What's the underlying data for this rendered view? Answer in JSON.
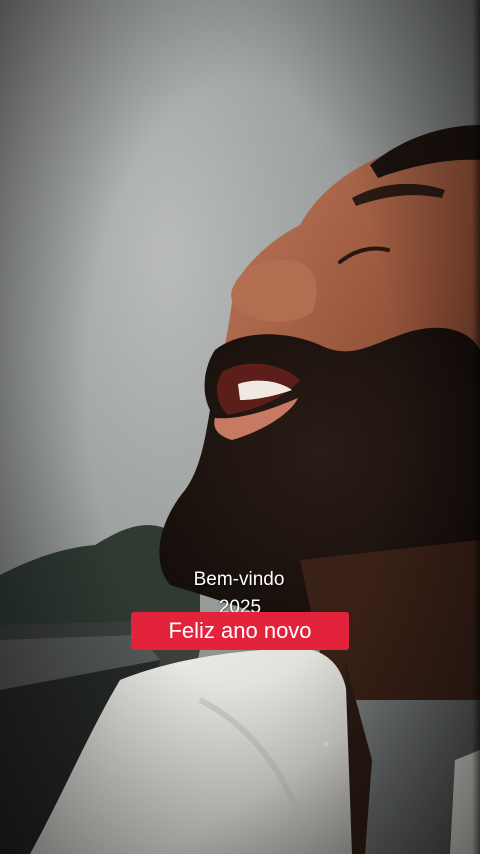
{
  "captions": {
    "line1": "Bem-vindo",
    "line2": "2025",
    "badge": "Feliz ano novo"
  },
  "colors": {
    "badge_background": "#e3223c",
    "caption_text": "#ffffff"
  }
}
